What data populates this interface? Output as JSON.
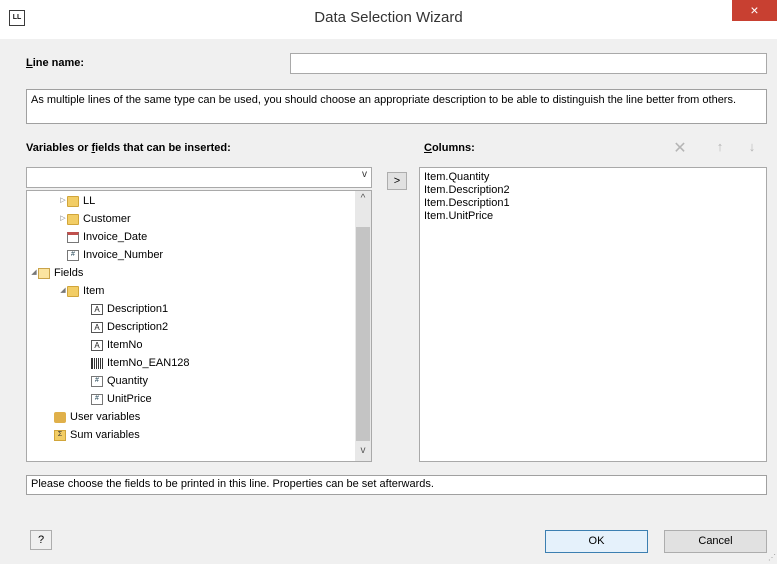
{
  "window": {
    "title": "Data Selection Wizard",
    "app_icon_text": "LL",
    "close_glyph": "×"
  },
  "line_name": {
    "label_first": "L",
    "label_rest": "ine name:",
    "value": ""
  },
  "hint_text": "As multiple lines of the same type can be used, you should choose an appropriate description to be able to distinguish the line better from others.",
  "left_panel": {
    "label_pre": "Variables or ",
    "label_key": "f",
    "label_post": "ields that can be inserted:",
    "combo_value": ""
  },
  "tree": [
    {
      "label": "LL",
      "icon": "folder-icon"
    },
    {
      "label": "Customer",
      "icon": "folder-icon"
    },
    {
      "label": "Invoice_Date",
      "icon": "calendar-icon"
    },
    {
      "label": "Invoice_Number",
      "icon": "number-icon"
    },
    {
      "label": "Fields",
      "icon": "fields-icon"
    },
    {
      "label": "Item",
      "icon": "folder-icon"
    },
    {
      "label": "Description1",
      "icon": "text-field-icon"
    },
    {
      "label": "Description2",
      "icon": "text-field-icon"
    },
    {
      "label": "ItemNo",
      "icon": "text-field-icon"
    },
    {
      "label": "ItemNo_EAN128",
      "icon": "barcode-icon"
    },
    {
      "label": "Quantity",
      "icon": "number-icon"
    },
    {
      "label": "UnitPrice",
      "icon": "number-icon"
    },
    {
      "label": "User variables",
      "icon": "user-variables-icon"
    },
    {
      "label": "Sum variables",
      "icon": "sum-variables-icon"
    }
  ],
  "transfer_button": ">",
  "right_panel": {
    "label_key": "C",
    "label_rest": "olumns:",
    "columns": [
      "Item.Quantity",
      "Item.Description2",
      "Item.Description1",
      "Item.UnitPrice"
    ],
    "delete_glyph": "✕",
    "up_glyph": "↑",
    "down_glyph": "↓"
  },
  "status_text": "Please choose the fields to be printed in this line. Properties can be set afterwards.",
  "buttons": {
    "help": "?",
    "ok": "OK",
    "cancel": "Cancel"
  },
  "scroll_glyphs": {
    "up": "^",
    "down": "v",
    "combo": "v"
  }
}
